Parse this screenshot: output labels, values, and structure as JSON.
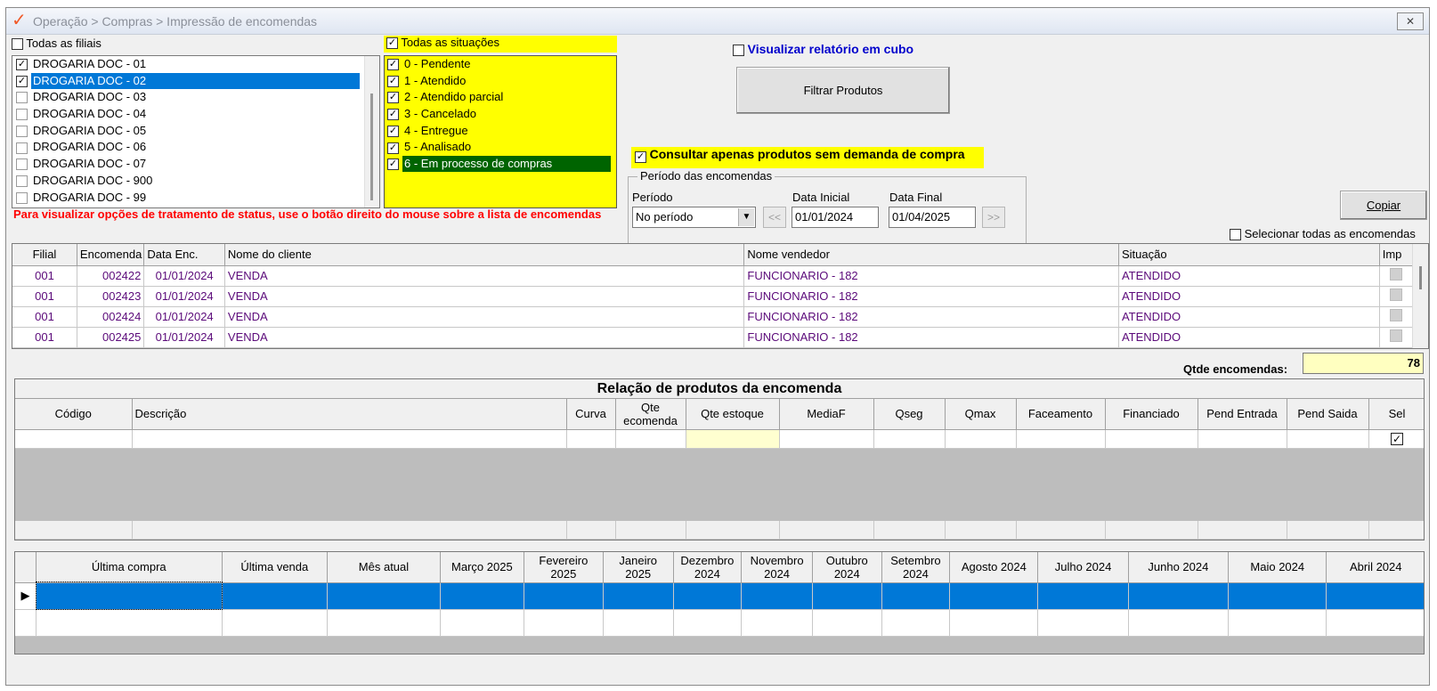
{
  "window": {
    "title": "Operação > Compras > Impressão de encomendas",
    "close_icon": "close-icon"
  },
  "branches": {
    "all_label": "Todas as filiais",
    "all_checked": false,
    "items": [
      {
        "label": "DROGARIA DOC - 01",
        "checked": true
      },
      {
        "label": "DROGARIA DOC - 02",
        "checked": true
      },
      {
        "label": "DROGARIA DOC - 03",
        "checked": false
      },
      {
        "label": "DROGARIA DOC - 04",
        "checked": false
      },
      {
        "label": "DROGARIA DOC - 05",
        "checked": false
      },
      {
        "label": "DROGARIA DOC - 06",
        "checked": false
      },
      {
        "label": "DROGARIA DOC - 07",
        "checked": false
      },
      {
        "label": "DROGARIA DOC - 900",
        "checked": false
      },
      {
        "label": "DROGARIA DOC - 99",
        "checked": false
      }
    ],
    "selected_index": 1
  },
  "situations": {
    "all_label": "Todas as situações",
    "all_checked": true,
    "items": [
      {
        "label": "0 - Pendente",
        "checked": true
      },
      {
        "label": "1 - Atendido",
        "checked": true
      },
      {
        "label": "2 - Atendido parcial",
        "checked": true
      },
      {
        "label": "3 - Cancelado",
        "checked": true
      },
      {
        "label": "4 - Entregue",
        "checked": true
      },
      {
        "label": "5 - Analisado",
        "checked": true
      },
      {
        "label": "6 - Em processo de compras",
        "checked": true
      }
    ],
    "selected_index": 6,
    "highlight_color": "#ffff00"
  },
  "note": "Para visualizar opções de tratamento de status, use o botão direito do mouse sobre a lista de encomendas",
  "cubo": {
    "label": "Visualizar relatório em cubo",
    "checked": false
  },
  "filter_button": "Filtrar Produtos",
  "consult": {
    "label": "Consultar apenas produtos sem demanda de compra",
    "checked": true
  },
  "period": {
    "legend": "Período das encomendas",
    "period_label": "Período",
    "period_value": "No período",
    "start_label": "Data Inicial",
    "start_value": "01/01/2024",
    "end_label": "Data Final",
    "end_value": "01/04/2025",
    "prev_label": "<<",
    "next_label": ">>"
  },
  "copy_button": "Copiar",
  "select_all_orders": {
    "label": "Selecionar todas as encomendas",
    "checked": false
  },
  "orders": {
    "columns": [
      "Filial",
      "Encomenda",
      "Data Enc.",
      "Nome do cliente",
      "Nome vendedor",
      "Situação",
      "Imp"
    ],
    "rows": [
      {
        "filial": "001",
        "encomenda": "002422",
        "data": "01/01/2024",
        "cliente": "VENDA",
        "vendedor": "FUNCIONARIO - 182",
        "situacao": "ATENDIDO"
      },
      {
        "filial": "001",
        "encomenda": "002423",
        "data": "01/01/2024",
        "cliente": "VENDA",
        "vendedor": "FUNCIONARIO - 182",
        "situacao": "ATENDIDO"
      },
      {
        "filial": "001",
        "encomenda": "002424",
        "data": "01/01/2024",
        "cliente": "VENDA",
        "vendedor": "FUNCIONARIO - 182",
        "situacao": "ATENDIDO"
      },
      {
        "filial": "001",
        "encomenda": "002425",
        "data": "01/01/2024",
        "cliente": "VENDA",
        "vendedor": "FUNCIONARIO - 182",
        "situacao": "ATENDIDO"
      }
    ]
  },
  "qtde": {
    "label": "Qtde encomendas:",
    "value": "78"
  },
  "products": {
    "title": "Relação de produtos da encomenda",
    "columns": [
      "Código",
      "Descrição",
      "Curva",
      "Qte ecomenda",
      "Qte estoque",
      "MediaF",
      "Qseg",
      "Qmax",
      "Faceamento",
      "Financiado",
      "Pend Entrada",
      "Pend Saida",
      "Sel"
    ],
    "sel_checked": true
  },
  "history": {
    "columns": [
      "Última compra",
      "Última venda",
      "Mês atual",
      "Março 2025",
      "Fevereiro 2025",
      "Janeiro 2025",
      "Dezembro 2024",
      "Novembro 2024",
      "Outubro 2024",
      "Setembro 2024",
      "Agosto 2024",
      "Julho 2024",
      "Junho 2024",
      "Maio 2024",
      "Abril 2024"
    ],
    "selection_color": "#0078d7"
  }
}
